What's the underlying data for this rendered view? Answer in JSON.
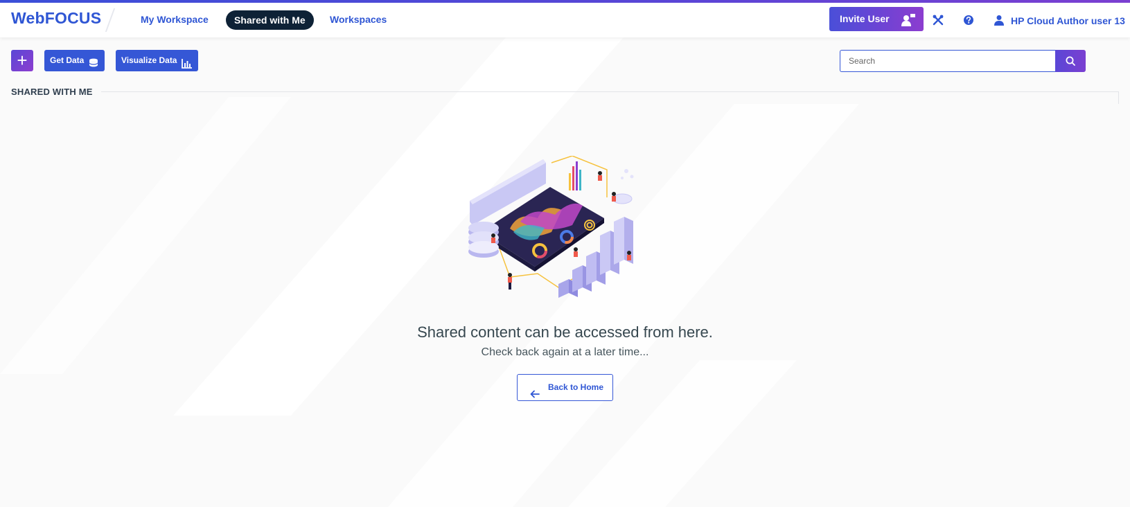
{
  "header": {
    "brand": "WebFOCUS",
    "nav": {
      "my_workspace": "My Workspace",
      "shared_with_me": "Shared with Me",
      "workspaces": "Workspaces"
    },
    "invite_label": "Invite User",
    "user_name": "HP Cloud Author user 13",
    "icons": {
      "invite": "add-user-icon",
      "tools": "tools-icon",
      "help": "help-icon",
      "user": "user-icon"
    }
  },
  "toolbar": {
    "create_symbol": "+",
    "get_data_label": "Get Data",
    "visualize_data_label": "Visualize Data",
    "icons": {
      "get_data": "database-icon",
      "visualize": "bar-chart-icon"
    }
  },
  "search": {
    "placeholder": "Search",
    "value": "",
    "icon": "search-icon"
  },
  "section": {
    "title": "SHARED WITH ME"
  },
  "empty_state": {
    "title": "Shared content can be accessed from here.",
    "subtitle": "Check back again at a later time...",
    "back_label": "Back to Home",
    "illustration": "isometric-data-dashboard-illustration"
  },
  "colors": {
    "brand_blue": "#2f56d4",
    "button_blue": "#3557d6",
    "accent_purple": "#7b3fd1",
    "active_pill": "#0e2236",
    "background": "#fafafa"
  }
}
